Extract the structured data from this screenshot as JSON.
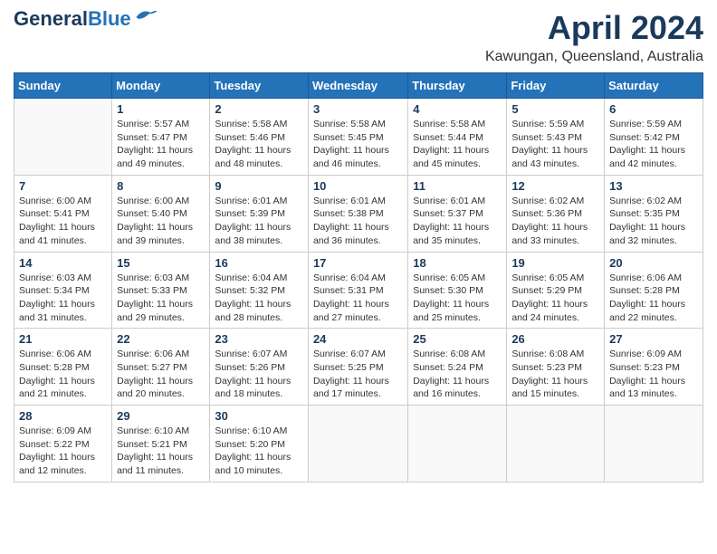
{
  "logo": {
    "line1": "General",
    "line2": "Blue"
  },
  "title": "April 2024",
  "location": "Kawungan, Queensland, Australia",
  "weekdays": [
    "Sunday",
    "Monday",
    "Tuesday",
    "Wednesday",
    "Thursday",
    "Friday",
    "Saturday"
  ],
  "weeks": [
    [
      {
        "day": "",
        "info": ""
      },
      {
        "day": "1",
        "info": "Sunrise: 5:57 AM\nSunset: 5:47 PM\nDaylight: 11 hours\nand 49 minutes."
      },
      {
        "day": "2",
        "info": "Sunrise: 5:58 AM\nSunset: 5:46 PM\nDaylight: 11 hours\nand 48 minutes."
      },
      {
        "day": "3",
        "info": "Sunrise: 5:58 AM\nSunset: 5:45 PM\nDaylight: 11 hours\nand 46 minutes."
      },
      {
        "day": "4",
        "info": "Sunrise: 5:58 AM\nSunset: 5:44 PM\nDaylight: 11 hours\nand 45 minutes."
      },
      {
        "day": "5",
        "info": "Sunrise: 5:59 AM\nSunset: 5:43 PM\nDaylight: 11 hours\nand 43 minutes."
      },
      {
        "day": "6",
        "info": "Sunrise: 5:59 AM\nSunset: 5:42 PM\nDaylight: 11 hours\nand 42 minutes."
      }
    ],
    [
      {
        "day": "7",
        "info": "Sunrise: 6:00 AM\nSunset: 5:41 PM\nDaylight: 11 hours\nand 41 minutes."
      },
      {
        "day": "8",
        "info": "Sunrise: 6:00 AM\nSunset: 5:40 PM\nDaylight: 11 hours\nand 39 minutes."
      },
      {
        "day": "9",
        "info": "Sunrise: 6:01 AM\nSunset: 5:39 PM\nDaylight: 11 hours\nand 38 minutes."
      },
      {
        "day": "10",
        "info": "Sunrise: 6:01 AM\nSunset: 5:38 PM\nDaylight: 11 hours\nand 36 minutes."
      },
      {
        "day": "11",
        "info": "Sunrise: 6:01 AM\nSunset: 5:37 PM\nDaylight: 11 hours\nand 35 minutes."
      },
      {
        "day": "12",
        "info": "Sunrise: 6:02 AM\nSunset: 5:36 PM\nDaylight: 11 hours\nand 33 minutes."
      },
      {
        "day": "13",
        "info": "Sunrise: 6:02 AM\nSunset: 5:35 PM\nDaylight: 11 hours\nand 32 minutes."
      }
    ],
    [
      {
        "day": "14",
        "info": "Sunrise: 6:03 AM\nSunset: 5:34 PM\nDaylight: 11 hours\nand 31 minutes."
      },
      {
        "day": "15",
        "info": "Sunrise: 6:03 AM\nSunset: 5:33 PM\nDaylight: 11 hours\nand 29 minutes."
      },
      {
        "day": "16",
        "info": "Sunrise: 6:04 AM\nSunset: 5:32 PM\nDaylight: 11 hours\nand 28 minutes."
      },
      {
        "day": "17",
        "info": "Sunrise: 6:04 AM\nSunset: 5:31 PM\nDaylight: 11 hours\nand 27 minutes."
      },
      {
        "day": "18",
        "info": "Sunrise: 6:05 AM\nSunset: 5:30 PM\nDaylight: 11 hours\nand 25 minutes."
      },
      {
        "day": "19",
        "info": "Sunrise: 6:05 AM\nSunset: 5:29 PM\nDaylight: 11 hours\nand 24 minutes."
      },
      {
        "day": "20",
        "info": "Sunrise: 6:06 AM\nSunset: 5:28 PM\nDaylight: 11 hours\nand 22 minutes."
      }
    ],
    [
      {
        "day": "21",
        "info": "Sunrise: 6:06 AM\nSunset: 5:28 PM\nDaylight: 11 hours\nand 21 minutes."
      },
      {
        "day": "22",
        "info": "Sunrise: 6:06 AM\nSunset: 5:27 PM\nDaylight: 11 hours\nand 20 minutes."
      },
      {
        "day": "23",
        "info": "Sunrise: 6:07 AM\nSunset: 5:26 PM\nDaylight: 11 hours\nand 18 minutes."
      },
      {
        "day": "24",
        "info": "Sunrise: 6:07 AM\nSunset: 5:25 PM\nDaylight: 11 hours\nand 17 minutes."
      },
      {
        "day": "25",
        "info": "Sunrise: 6:08 AM\nSunset: 5:24 PM\nDaylight: 11 hours\nand 16 minutes."
      },
      {
        "day": "26",
        "info": "Sunrise: 6:08 AM\nSunset: 5:23 PM\nDaylight: 11 hours\nand 15 minutes."
      },
      {
        "day": "27",
        "info": "Sunrise: 6:09 AM\nSunset: 5:23 PM\nDaylight: 11 hours\nand 13 minutes."
      }
    ],
    [
      {
        "day": "28",
        "info": "Sunrise: 6:09 AM\nSunset: 5:22 PM\nDaylight: 11 hours\nand 12 minutes."
      },
      {
        "day": "29",
        "info": "Sunrise: 6:10 AM\nSunset: 5:21 PM\nDaylight: 11 hours\nand 11 minutes."
      },
      {
        "day": "30",
        "info": "Sunrise: 6:10 AM\nSunset: 5:20 PM\nDaylight: 11 hours\nand 10 minutes."
      },
      {
        "day": "",
        "info": ""
      },
      {
        "day": "",
        "info": ""
      },
      {
        "day": "",
        "info": ""
      },
      {
        "day": "",
        "info": ""
      }
    ]
  ]
}
